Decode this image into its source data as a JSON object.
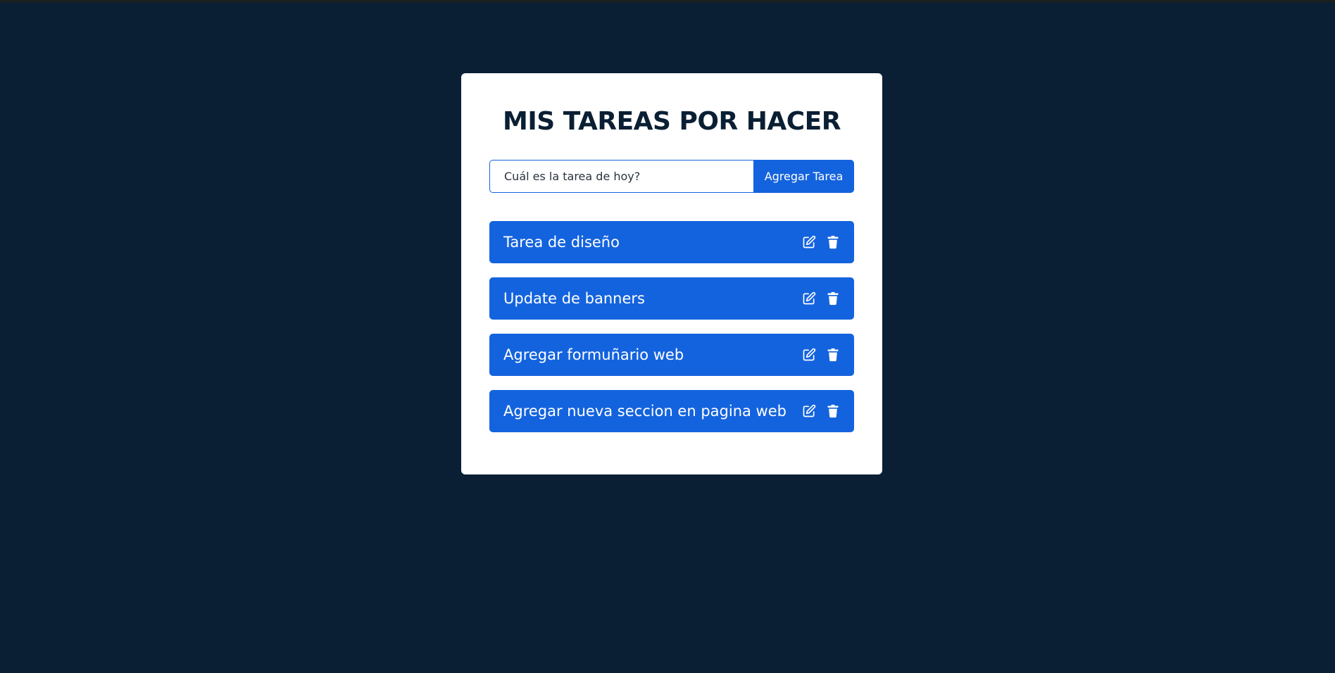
{
  "app": {
    "title": "MIS TAREAS POR HACER"
  },
  "form": {
    "placeholder": "Cuál es la tarea de hoy?",
    "value": "",
    "add_label": "Agregar Tarea"
  },
  "tasks": [
    {
      "text": "Tarea de diseño",
      "edit_icon": "edit-icon",
      "delete_icon": "trash-icon"
    },
    {
      "text": "Update de banners",
      "edit_icon": "edit-icon",
      "delete_icon": "trash-icon"
    },
    {
      "text": "Agregar formuñario web",
      "edit_icon": "edit-icon",
      "delete_icon": "trash-icon"
    },
    {
      "text": "Agregar nueva seccion en pagina web",
      "edit_icon": "edit-icon",
      "delete_icon": "trash-icon"
    }
  ],
  "colors": {
    "background": "#0a1f33",
    "card": "#ffffff",
    "accent": "#1463de",
    "title": "#0a1f33"
  }
}
